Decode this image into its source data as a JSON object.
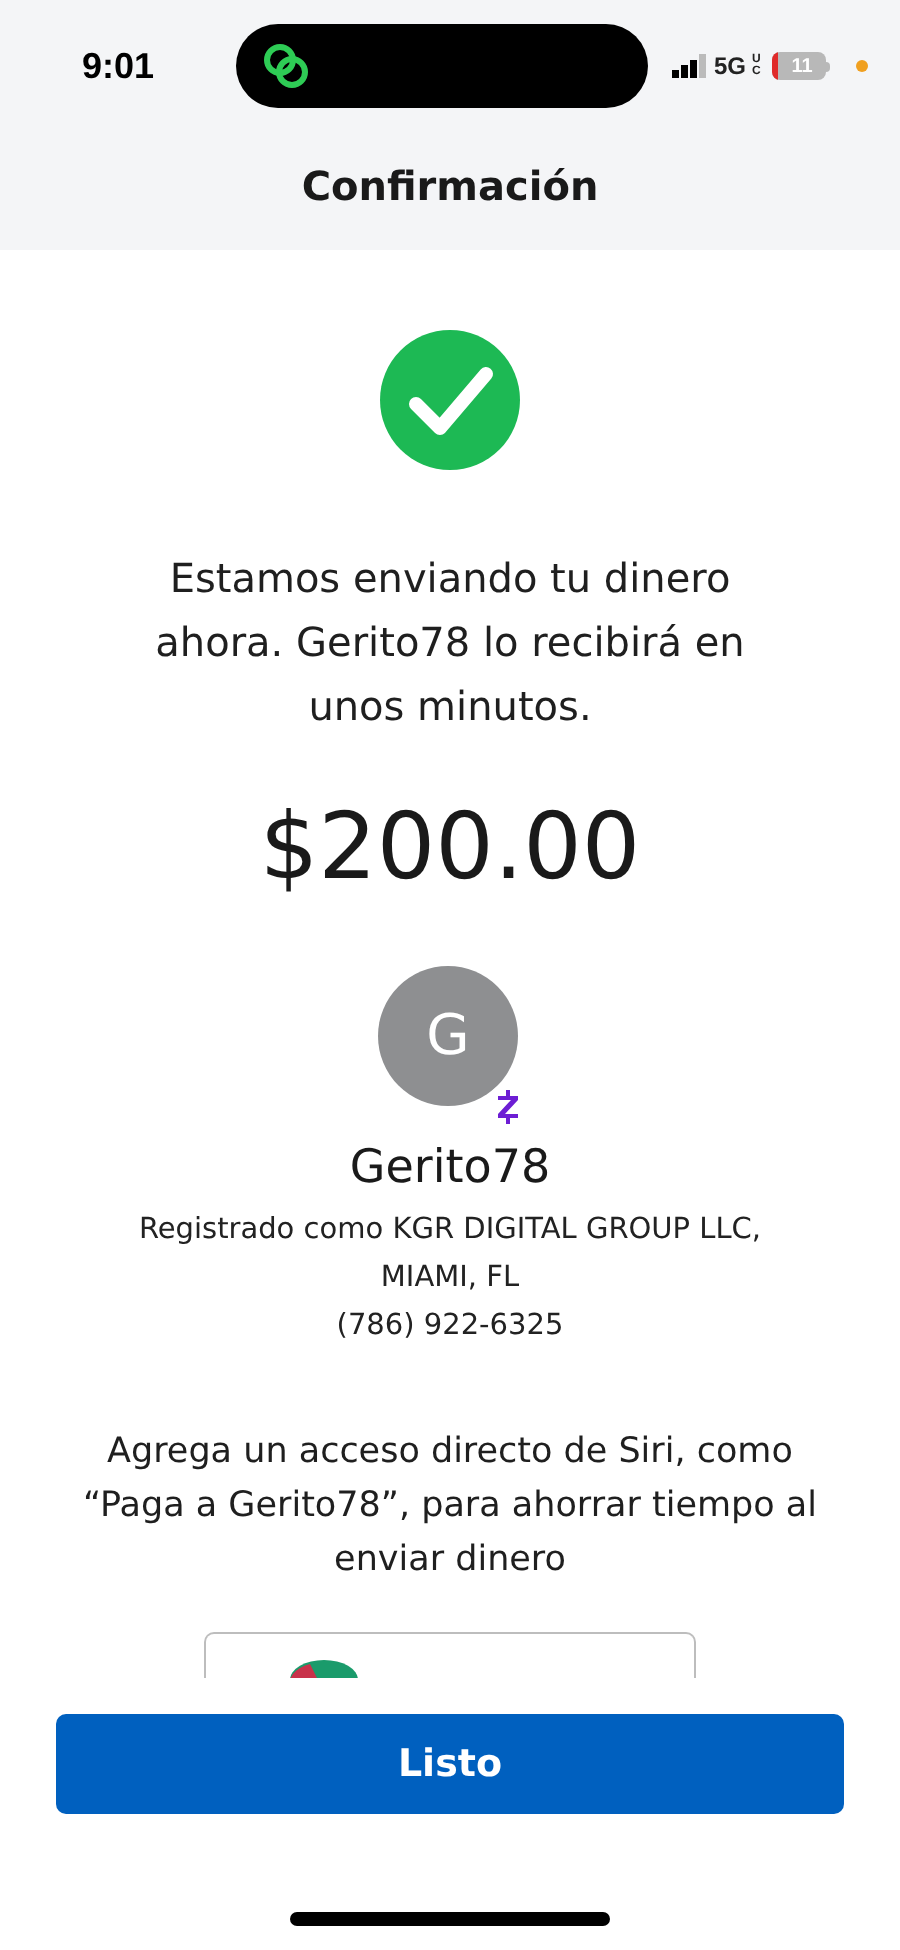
{
  "status_bar": {
    "time": "9:01",
    "network": "5G",
    "network_badge": "UC",
    "battery": "11"
  },
  "header": {
    "title": "Confirmación"
  },
  "confirmation": {
    "message": "Estamos enviando tu dinero ahora. Gerito78 lo recibirá en unos minutos.",
    "amount": "$200.00"
  },
  "recipient": {
    "initial": "G",
    "name": "Gerito78",
    "registration": "Registrado como KGR DIGITAL GROUP LLC, MIAMI, FL",
    "phone": "(786) 922-6325"
  },
  "siri_prompt": "Agrega un acceso directo de Siri, como “Paga a Gerito78”, para ahorrar tiempo al enviar dinero",
  "primary_button": {
    "label": "Listo"
  }
}
